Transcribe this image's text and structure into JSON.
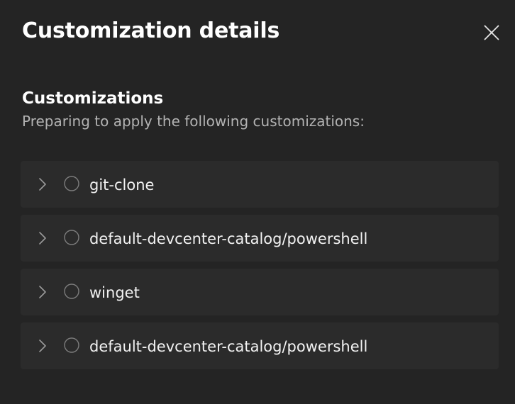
{
  "panel": {
    "title": "Customization details",
    "close_icon": "close-icon"
  },
  "section": {
    "heading": "Customizations",
    "subtitle": "Preparing to apply the following customizations:"
  },
  "customizations": [
    {
      "label": "git-clone",
      "expand_icon": "chevron-right-icon",
      "status_icon": "pending-circle-icon"
    },
    {
      "label": "default-devcenter-catalog/powershell",
      "expand_icon": "chevron-right-icon",
      "status_icon": "pending-circle-icon"
    },
    {
      "label": "winget",
      "expand_icon": "chevron-right-icon",
      "status_icon": "pending-circle-icon"
    },
    {
      "label": "default-devcenter-catalog/powershell",
      "expand_icon": "chevron-right-icon",
      "status_icon": "pending-circle-icon"
    }
  ],
  "colors": {
    "background": "#242424",
    "row_background": "#2b2b2b",
    "primary_text": "#ffffff",
    "secondary_text": "#b3b3b3",
    "icon_stroke": "#8a8a8a"
  }
}
